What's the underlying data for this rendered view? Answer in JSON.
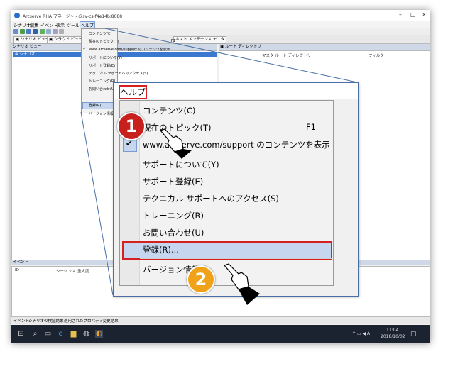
{
  "window": {
    "title": "Arcserve RHA マネージャ - @sv-cs-f4e14b:8088"
  },
  "menubar": [
    "シナリオ",
    "編集",
    "イベント",
    "表示",
    "ツール",
    "ヘルプ"
  ],
  "tabs": [
    "シナリオ ビュー",
    "クラウド ビュー",
    "ホスト メンテナンス モニタ"
  ],
  "scenario_panel": {
    "title": "シナリオ ビュー",
    "tree_item": "シナリオ"
  },
  "root_panel": {
    "title": "ルート ディレクトリ",
    "columns": [
      "マスタ ルート ディレクトリ",
      "フィルタ"
    ]
  },
  "small_menu": {
    "items": [
      "コンテンツ(C)",
      "現在のトピック(T)",
      "www.arcserve.com/support のコンテンツを表示",
      "サポートについて(Y)",
      "サポート登録(E)",
      "テクニカル サポートへのアクセス(S)",
      "トレーニング(R)",
      "お問い合わせ(U)",
      "登録(R)...",
      "バージョン情報"
    ],
    "shortcut": "F1"
  },
  "events_panel": {
    "title": "イベント",
    "columns": [
      "ID",
      "シーケンス",
      "重大度"
    ]
  },
  "statusbar": [
    "イベント",
    "シナリオの検証結果",
    "適用されたプロパティ変更結果"
  ],
  "callout": {
    "menu_title": "ヘルプ",
    "items": [
      {
        "label": "コンテンツ(C)"
      },
      {
        "label": "現在のトピック(T)",
        "shortcut": "F1"
      },
      {
        "label": "www.arcserve.com/support のコンテンツを表示",
        "checked": true
      },
      {
        "label": "サポートについて(Y)"
      },
      {
        "label": "サポート登録(E)"
      },
      {
        "label": "テクニカル サポートへのアクセス(S)"
      },
      {
        "label": "トレーニング(R)"
      },
      {
        "label": "お問い合わせ(U)"
      },
      {
        "label": "登録(R)...",
        "highlighted": true
      },
      {
        "label": "バージョン情報"
      }
    ]
  },
  "steps": [
    "1",
    "2"
  ],
  "taskbar": {
    "time": "11:04",
    "date": "2018/10/02",
    "ime": "A"
  },
  "colors": {
    "highlight": "#c6d6ee",
    "annotation_red": "#d42020",
    "step1": "#c8201c",
    "step2": "#f0a319",
    "taskbar": "#1b2230"
  }
}
